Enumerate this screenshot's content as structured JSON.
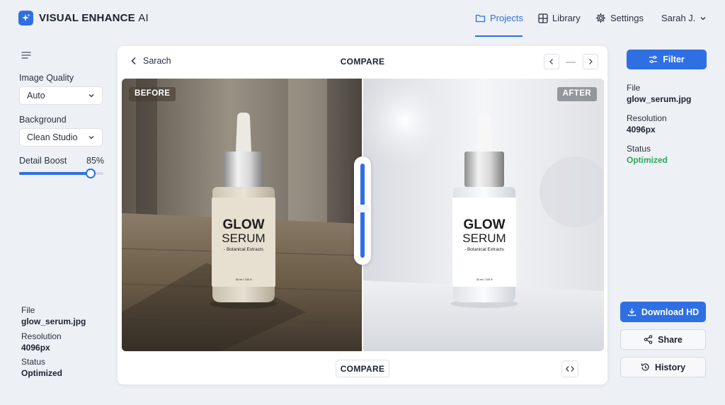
{
  "app": {
    "name_bold": "VISUAL ENHANCE",
    "name_light": "AI",
    "logo_icon": "sparkle-icon"
  },
  "nav": {
    "projects": "Projects",
    "library": "Library",
    "settings": "Settings",
    "user": "Sarah J."
  },
  "controls": {
    "image_quality_label": "Image Quality",
    "image_quality_value": "Auto",
    "background_label": "Background",
    "background_value": "Clean Studio",
    "detail_boost_label": "Detail Boost",
    "detail_boost_value": "85%",
    "detail_boost_fraction": 0.85
  },
  "left_meta": {
    "file_label": "File",
    "file_value": "glow_serum.jpg",
    "resolution_label": "Resolution",
    "resolution_value": "4096px",
    "status_label": "Status",
    "status_value": "Optimized"
  },
  "compare": {
    "back_label": "Sarach",
    "title": "COMPARE",
    "before_tag": "BEFORE",
    "after_tag": "AFTER",
    "bottom_button": "COMPARE"
  },
  "product": {
    "line1": "GLOW",
    "line2": "SERUM",
    "line3": "- Botanical Extracts",
    "volume": "30 ml / 100 fl"
  },
  "right": {
    "filter_label": "Filter",
    "file_label": "File",
    "file_value": "glow_serum.jpg",
    "resolution_label": "Resolution",
    "resolution_value": "4096px",
    "status_label": "Status",
    "status_value": "Optimized",
    "download_label": "Download HD",
    "share_label": "Share",
    "history_label": "History"
  },
  "colors": {
    "accent": "#2f6fe4",
    "status_ok": "#2ea65a",
    "background": "#edf0f4"
  }
}
